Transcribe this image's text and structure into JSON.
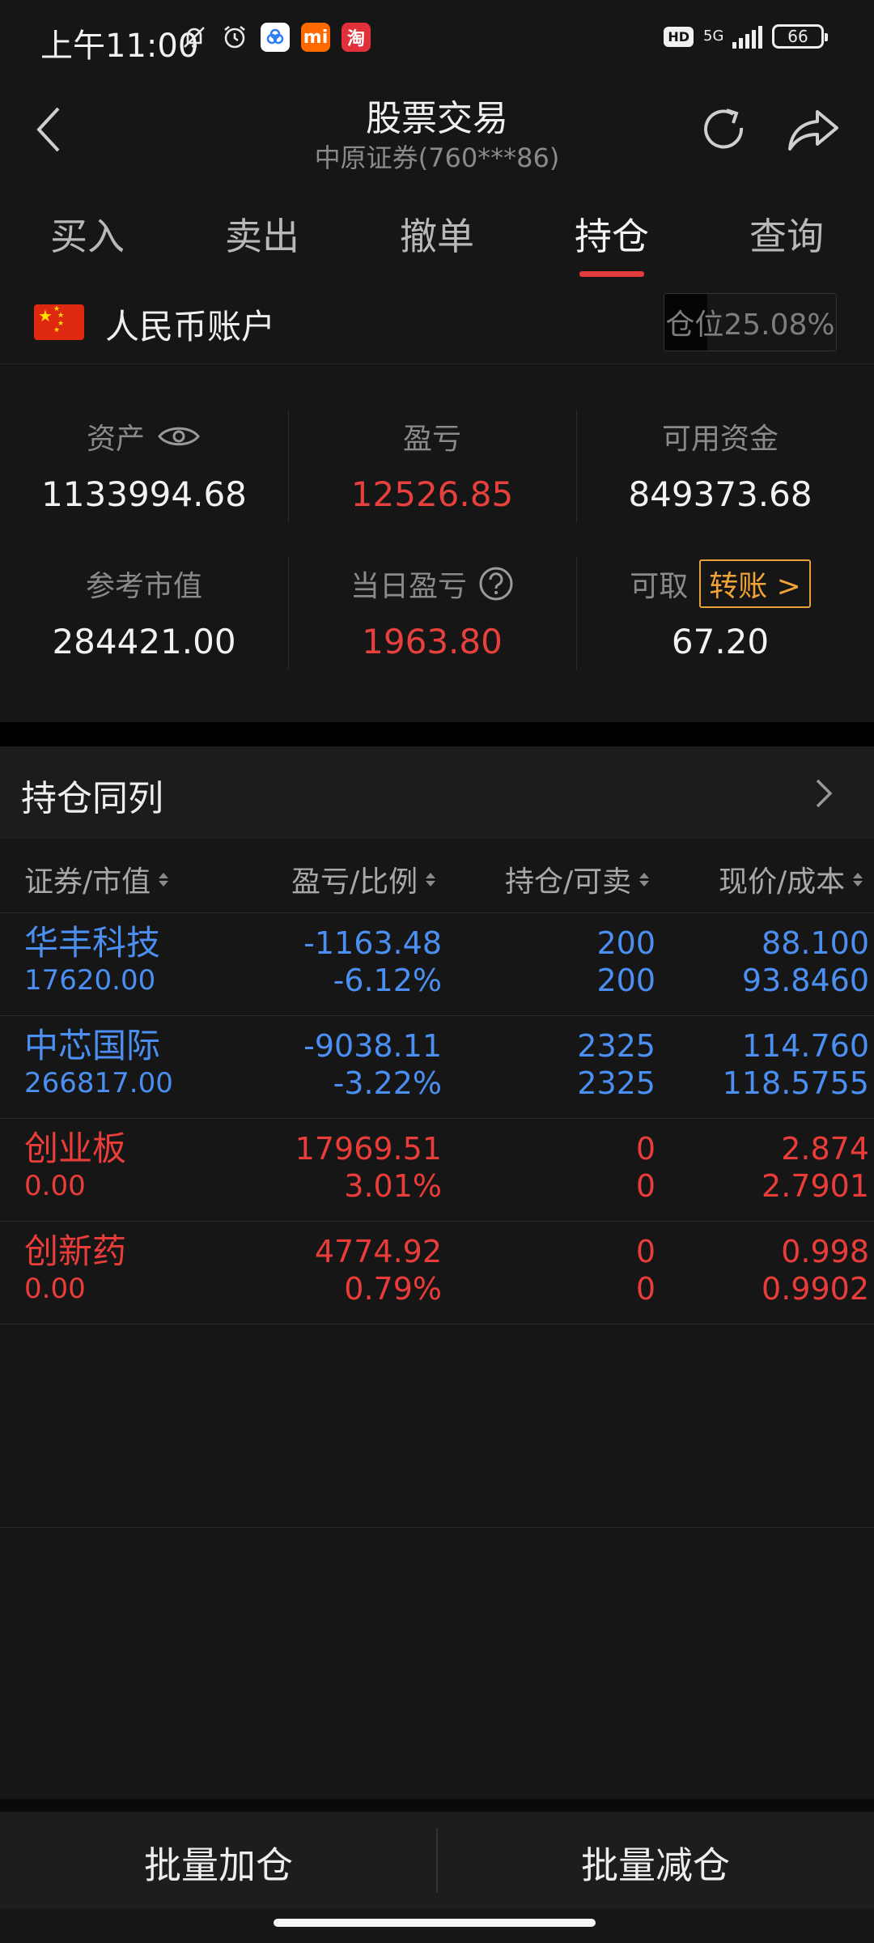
{
  "status_bar": {
    "time": "上午11:00",
    "network": "5G",
    "battery": "66",
    "hd": "HD",
    "app_icon_1": "淘",
    "app_icon_2": "mi"
  },
  "header": {
    "title": "股票交易",
    "subtitle": "中原证券(760***86)"
  },
  "tabs": [
    {
      "label": "买入",
      "active": false
    },
    {
      "label": "卖出",
      "active": false
    },
    {
      "label": "撤单",
      "active": false
    },
    {
      "label": "持仓",
      "active": true
    },
    {
      "label": "查询",
      "active": false
    }
  ],
  "account": {
    "label": "人民币账户",
    "position_label": "仓位25.08%",
    "position_ratio": 0.2508
  },
  "stats": {
    "assets_label": "资产",
    "assets_value": "1133994.68",
    "pnl_label": "盈亏",
    "pnl_value": "12526.85",
    "available_label": "可用资金",
    "available_value": "849373.68",
    "market_value_label": "参考市值",
    "market_value_value": "284421.00",
    "daily_pnl_label": "当日盈亏",
    "daily_pnl_value": "1963.80",
    "withdrawable_label": "可取",
    "transfer_label": "转账 >",
    "withdrawable_value": "67.20"
  },
  "section": {
    "title": "持仓同列"
  },
  "table": {
    "headers": [
      "证券/市值",
      "盈亏/比例",
      "持仓/可卖",
      "现价/成本"
    ],
    "rows": [
      {
        "name": "华丰科技",
        "market_value": "17620.00",
        "pnl": "-1163.48",
        "ratio": "-6.12%",
        "holding": "200",
        "sellable": "200",
        "price": "88.100",
        "cost": "93.8460",
        "color": "blue"
      },
      {
        "name": "中芯国际",
        "market_value": "266817.00",
        "pnl": "-9038.11",
        "ratio": "-3.22%",
        "holding": "2325",
        "sellable": "2325",
        "price": "114.760",
        "cost": "118.5755",
        "color": "blue"
      },
      {
        "name": "创业板",
        "market_value": "0.00",
        "pnl": "17969.51",
        "ratio": "3.01%",
        "holding": "0",
        "sellable": "0",
        "price": "2.874",
        "cost": "2.7901",
        "color": "red"
      },
      {
        "name": "创新药",
        "market_value": "0.00",
        "pnl": "4774.92",
        "ratio": "0.79%",
        "holding": "0",
        "sellable": "0",
        "price": "0.998",
        "cost": "0.9902",
        "color": "red"
      }
    ]
  },
  "bottom": {
    "add_label": "批量加仓",
    "reduce_label": "批量减仓"
  },
  "colors": {
    "accent_red": "#e8413d",
    "accent_blue": "#4b8ff2",
    "transfer_orange": "#f0a438"
  }
}
